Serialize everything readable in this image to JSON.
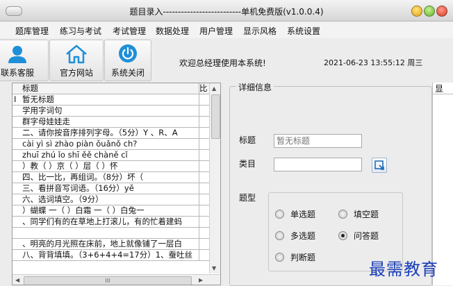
{
  "window": {
    "title": "题目录入--------------------------单机免费版(v1.0.0.4)"
  },
  "menu": [
    "题库管理",
    "练习与考试",
    "考试管理",
    "数据处理",
    "用户管理",
    "显示风格",
    "系统设置"
  ],
  "toolbar": {
    "buttons": [
      {
        "label": "联系客服",
        "icon": "user-icon"
      },
      {
        "label": "官方网站",
        "icon": "home-icon"
      },
      {
        "label": "系统关闭",
        "icon": "power-icon"
      }
    ],
    "welcome": "欢迎总经理使用本系统!",
    "datetime": "2021-06-23 13:55:12  周三"
  },
  "grid": {
    "columns": [
      "标题",
      "比"
    ],
    "rows": [
      {
        "marker": "I",
        "title": "暂无标题"
      },
      {
        "marker": "",
        "title": "学用字词句"
      },
      {
        "marker": "",
        "title": "群字母娃娃走"
      },
      {
        "marker": "",
        "title": "二、请你按音序排列字母。（5分）Y 、R、A"
      },
      {
        "marker": "",
        "title": "cài   yì  sì    zhào  piàn  ǒuǎnǒ ch?"
      },
      {
        "marker": "",
        "title": "zhuī  zhú   ǐo  shī    ěě  chàně   cǐ"
      },
      {
        "marker": "",
        "title": "  ）教（     ）京（      ）层（       ）怀"
      },
      {
        "marker": "",
        "title": "四、比一比，再组词。（8分）坏（"
      },
      {
        "marker": "",
        "title": "三、看拼音写词语。（16分）yě"
      },
      {
        "marker": "",
        "title": "六、选词填空。（9分）"
      },
      {
        "marker": "",
        "title": "  ）蝴蝶    一（      ）白霜    一（      ）白兔一"
      },
      {
        "marker": "",
        "title": "、同学们有的在草地上打滚儿，有的忙着建蚂"
      },
      {
        "marker": "",
        "title": ""
      },
      {
        "marker": "",
        "title": "、明亮的月光照在床前，地上就像铺了一层白"
      },
      {
        "marker": "",
        "title": "八、背背填填。（3+6+4+4=17分）1、蚕吐丝"
      }
    ],
    "hscroll_thumb": "III"
  },
  "detail": {
    "group_label": "详细信息",
    "title_label": "标题",
    "title_placeholder": "暂无标题",
    "category_label": "类目",
    "type_label": "题型",
    "types": [
      {
        "label": "单选题",
        "checked": false
      },
      {
        "label": "填空题",
        "checked": false
      },
      {
        "label": "多选题",
        "checked": false
      },
      {
        "label": "问答题",
        "checked": true
      },
      {
        "label": "判断题",
        "checked": false
      }
    ],
    "right_strip_char": "显"
  },
  "watermark": "最需教育",
  "colors": {
    "accent": "#1a3db8",
    "icon_blue": "#1e8fd8"
  }
}
